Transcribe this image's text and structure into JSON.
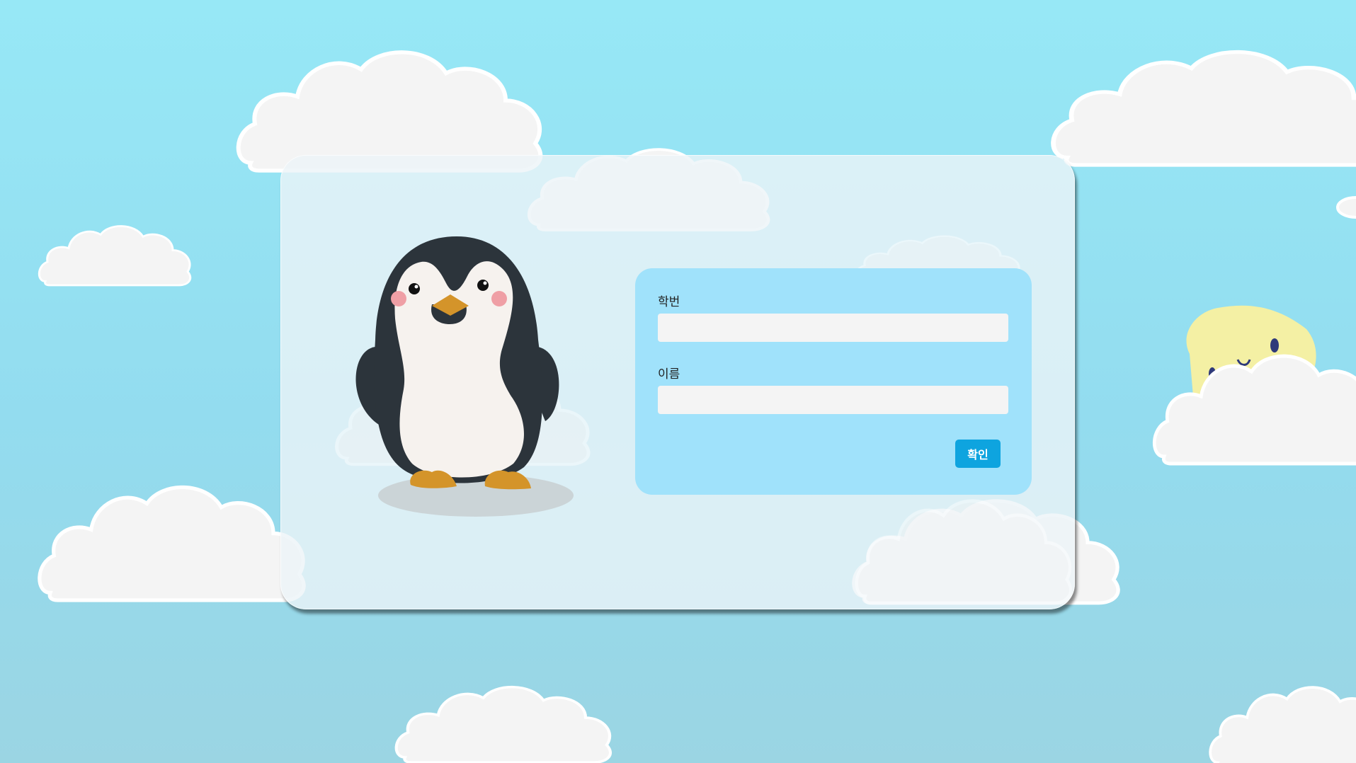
{
  "form": {
    "student_id_label": "학번",
    "student_id_value": "",
    "name_label": "이름",
    "name_value": "",
    "confirm_label": "확인"
  },
  "colors": {
    "sky": "#97e8f6",
    "panel": "#a0e2fb",
    "button": "#0ea4df"
  },
  "icons": {
    "mascot": "penguin-illustration",
    "sun": "sun-face-icon"
  }
}
